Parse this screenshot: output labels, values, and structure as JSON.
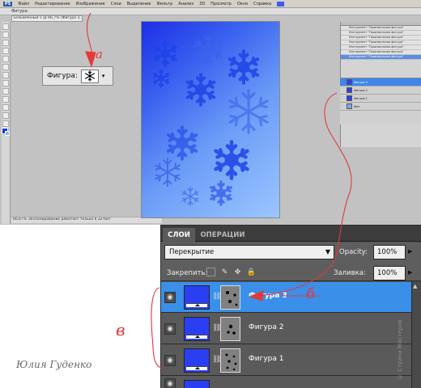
{
  "menubar": {
    "logo": "PS",
    "items": [
      "Файл",
      "Редактирование",
      "Изображение",
      "Слои",
      "Выделение",
      "Фильтр",
      "Анализ",
      "3D",
      "Просмотр",
      "Окно",
      "Справка"
    ]
  },
  "optbar": {
    "text": "Фигура:"
  },
  "document_tab": "Безымянный-1 @ 66,7% (Фигура 3, RGB/8)",
  "status_text": "66,67%   Экспонирование работает только в 32-бит",
  "shape_popup": {
    "label": "Фигура:"
  },
  "mini_panel": {
    "rows": [
      "Инструмент \"Произвольная фигура\"",
      "Инструмент \"Произвольная фигура\"",
      "Инструмент \"Произвольная фигура\"",
      "Инструмент \"Произвольная фигура\"",
      "Инструмент \"Произвольная фигура\"",
      "Инструмент \"Произвольная фигура\"",
      "Инструмент \"Произвольная фигура\""
    ],
    "layers": [
      "Фигура 3",
      "Фигура 2",
      "Фигура 1",
      "Фон"
    ]
  },
  "layers_panel": {
    "tabs": [
      "СЛОИ",
      "ОПЕРАЦИИ"
    ],
    "blend_mode": "Перекрытие",
    "opacity_label": "Opacity:",
    "opacity_value": "100%",
    "lock_label": "Закрепить:",
    "fill_label": "Заливка:",
    "fill_value": "100%",
    "layers": [
      {
        "name": "Фигура 3",
        "selected": true
      },
      {
        "name": "Фигура 2",
        "selected": false
      },
      {
        "name": "Фигура 1",
        "selected": false
      }
    ]
  },
  "annotations": {
    "a": "а",
    "b": "б",
    "v": "в",
    "signature": "Юлия Гуденко",
    "watermark": "© Страна Мастеров"
  },
  "colors": {
    "accent_red": "#e23a3a",
    "selected_layer": "#3a8fe8",
    "shape_fill": "#2b3ff2"
  }
}
